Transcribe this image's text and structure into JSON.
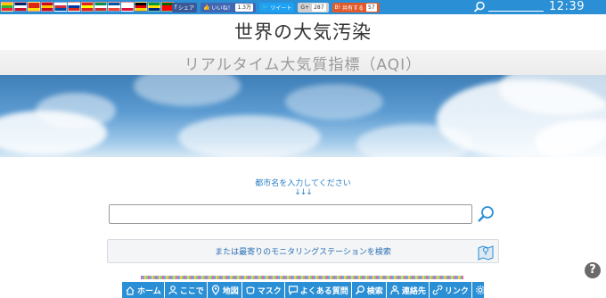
{
  "topbar": {
    "flags": [
      {
        "name": "myanmar-flag",
        "colors": [
          "#fecb00",
          "#34b233",
          "#ea2839"
        ]
      },
      {
        "name": "uk-flag",
        "colors": [
          "#012169",
          "#ffffff",
          "#c8102e"
        ]
      },
      {
        "name": "china-flag",
        "colors": [
          "#de2910",
          "#de2910",
          "#ffde00"
        ]
      },
      {
        "name": "spain-flag",
        "colors": [
          "#c60b1e",
          "#ffc400",
          "#c60b1e"
        ]
      },
      {
        "name": "korea-flag",
        "colors": [
          "#ffffff",
          "#cd2e3a",
          "#0047a0"
        ]
      },
      {
        "name": "russia-flag",
        "colors": [
          "#ffffff",
          "#0039a6",
          "#d52b1e"
        ]
      },
      {
        "name": "vietnam-flag",
        "colors": [
          "#da251d",
          "#ffff00",
          "#da251d"
        ]
      },
      {
        "name": "italy-flag",
        "colors": [
          "#009246",
          "#ffffff",
          "#ce2b37"
        ]
      },
      {
        "name": "france-flag",
        "colors": [
          "#0055a4",
          "#ffffff",
          "#ef4135"
        ]
      },
      {
        "name": "poland-flag",
        "colors": [
          "#ffffff",
          "#ffffff",
          "#dc143c"
        ]
      },
      {
        "name": "germany-flag",
        "colors": [
          "#000000",
          "#dd0000",
          "#ffce00"
        ]
      },
      {
        "name": "brazil-flag",
        "colors": [
          "#009c3b",
          "#ffdf00",
          "#002776"
        ]
      },
      {
        "name": "portugal-flag",
        "colors": [
          "#006600",
          "#ff0000",
          "#ff0000"
        ]
      }
    ],
    "social": {
      "facebook_share": "シェア",
      "like": "いいね！",
      "like_count": "1.3万",
      "tweet": "ツイート",
      "gplus": "G+",
      "gplus_count": "287",
      "hatena": "共有する",
      "hatena_count": "57"
    },
    "clock": "12:39",
    "accent": "#2a8fd5"
  },
  "header": {
    "title": "世界の大気汚染",
    "subtitle": "リアルタイム大気質指標（AQI）"
  },
  "search": {
    "prompt": "都市名を入力してください",
    "arrows": "↓↓↓",
    "input_value": "",
    "nearest_label": "または最寄りのモニタリングステーションを検索"
  },
  "nav": {
    "items": [
      {
        "label": "ホーム",
        "icon": "home-icon"
      },
      {
        "label": "ここで",
        "icon": "person-icon"
      },
      {
        "label": "地図",
        "icon": "pin-icon"
      },
      {
        "label": "マスク",
        "icon": "mask-icon"
      },
      {
        "label": "よくある質問",
        "icon": "chat-icon"
      },
      {
        "label": "検索",
        "icon": "search-icon"
      },
      {
        "label": "連絡先",
        "icon": "contact-icon"
      },
      {
        "label": "リンク",
        "icon": "link-icon"
      },
      {
        "label": "",
        "icon": "gear-icon"
      }
    ]
  },
  "help": "?"
}
